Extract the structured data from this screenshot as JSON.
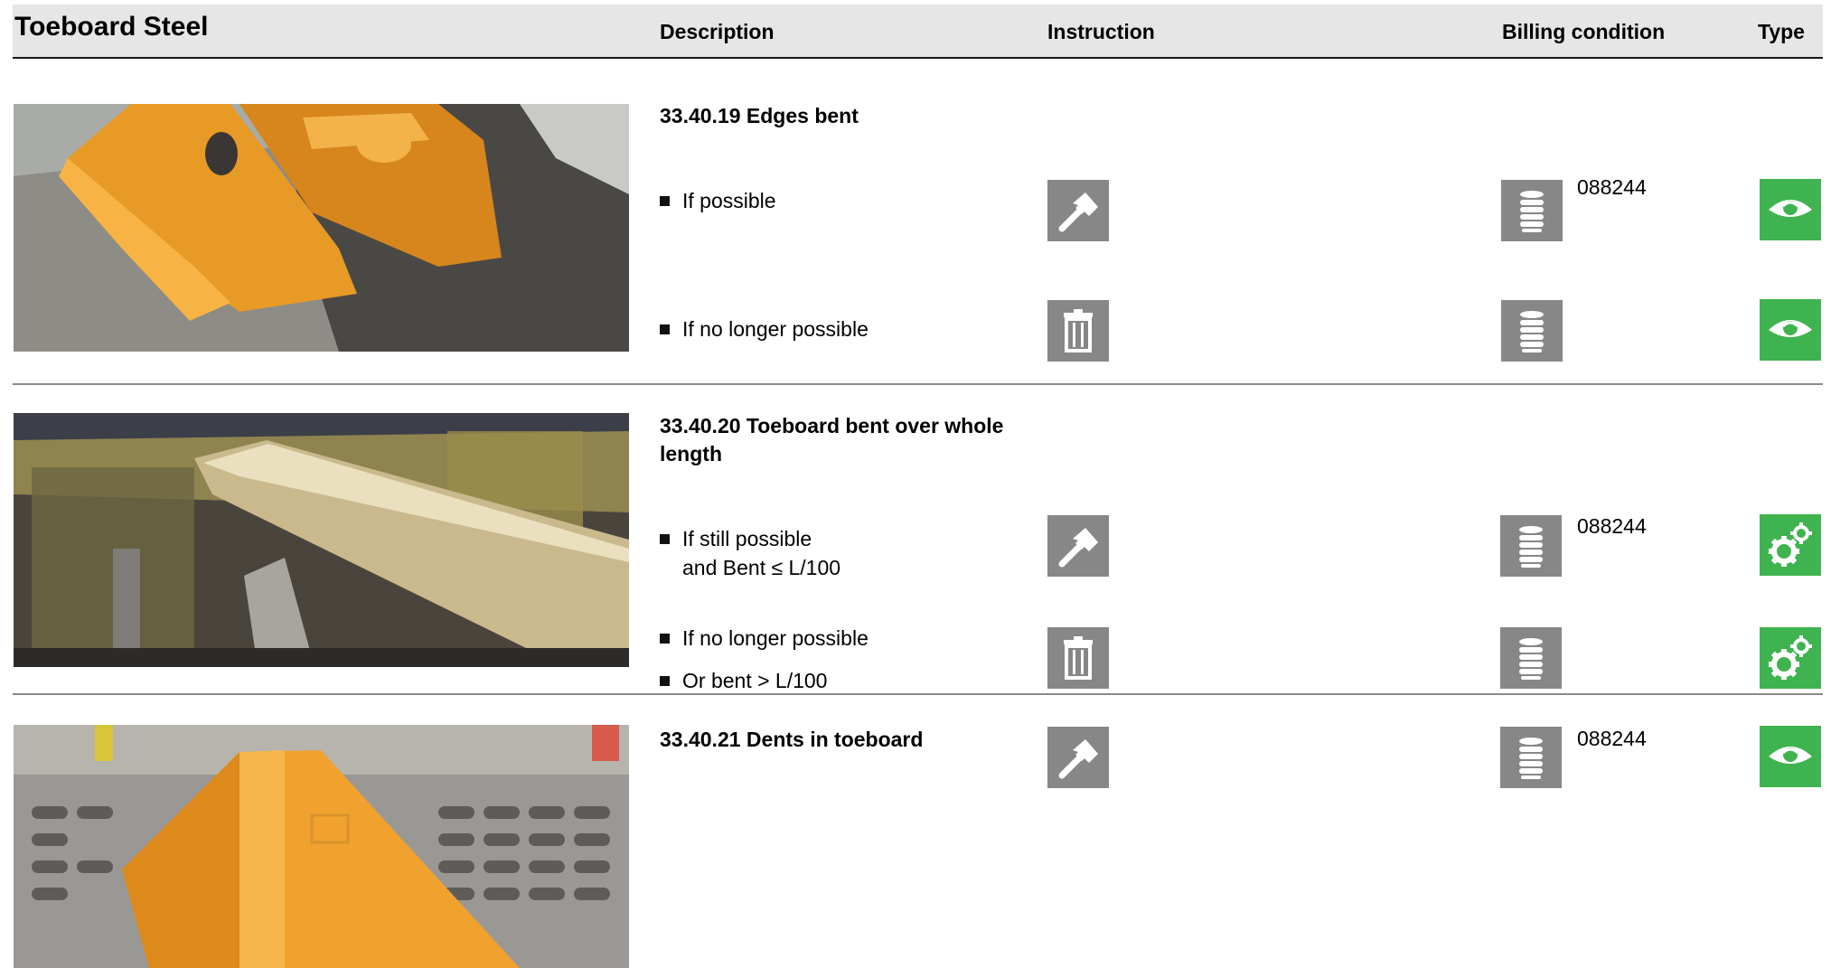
{
  "header": {
    "title": "Toeboard Steel",
    "col_description": "Description",
    "col_instruction": "Instruction",
    "col_billing": "Billing condition",
    "col_type": "Type"
  },
  "sections": [
    {
      "title": "33.40.19 Edges bent",
      "rows": [
        {
          "text": "If possible",
          "instruction_icon": "hammer-icon",
          "billing_icon": "coin-stack-icon",
          "code": "088244",
          "type_icon": "eye-icon"
        },
        {
          "text": "If no longer possible",
          "instruction_icon": "trash-icon",
          "billing_icon": "coin-stack-icon",
          "code": "",
          "type_icon": "eye-icon"
        }
      ]
    },
    {
      "title": "33.40.20 Toeboard bent over whole length",
      "rows": [
        {
          "text": "If still possible",
          "text2": "and Bent ≤ L/100",
          "instruction_icon": "hammer-icon",
          "billing_icon": "coin-stack-icon",
          "code": "088244",
          "type_icon": "gears-icon"
        },
        {
          "text": "If no longer possible",
          "instruction_icon": "trash-icon",
          "billing_icon": "coin-stack-icon",
          "code": "",
          "type_icon": "gears-icon"
        },
        {
          "text": "Or bent > L/100"
        }
      ]
    },
    {
      "title": "33.40.21 Dents in toeboard",
      "rows": [
        {
          "text": "",
          "instruction_icon": "hammer-icon",
          "billing_icon": "coin-stack-icon",
          "code": "088244",
          "type_icon": "eye-icon"
        }
      ]
    }
  ],
  "colors": {
    "header_bg": "#e6e6e6",
    "icon_gray": "#878787",
    "type_green": "#3fb34f"
  }
}
